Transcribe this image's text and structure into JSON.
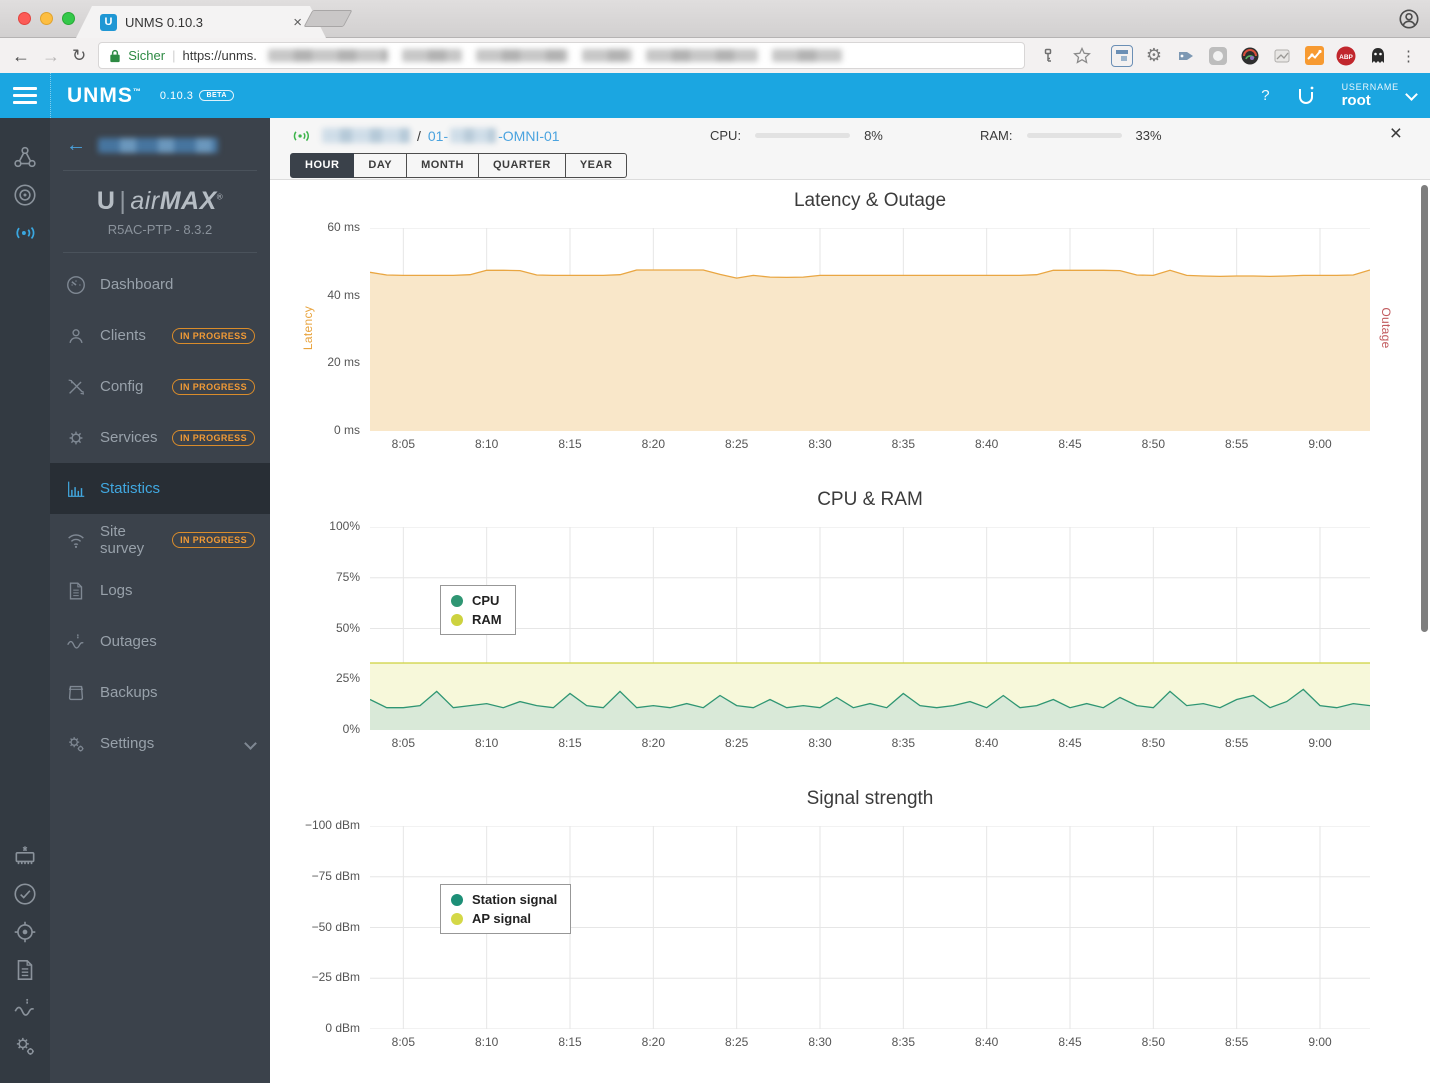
{
  "browser": {
    "tab_title": "UNMS 0.10.3",
    "favicon_letter": "U",
    "close_tab_glyph": "×",
    "nav": {
      "back": "←",
      "forward": "→",
      "reload": "↻"
    },
    "security_label": "Sicher",
    "url_divider": "|",
    "url_visible_text": "https://unms.",
    "menu_dots": "⋮",
    "extensions": [
      {
        "name": "key-icon"
      },
      {
        "name": "bookmark-star-icon"
      },
      {
        "name": "tab-window-extension-icon"
      },
      {
        "name": "gear-extension-icon"
      },
      {
        "name": "tag-extension-icon"
      },
      {
        "name": "circle-extension-icon"
      },
      {
        "name": "color-picker-extension-icon"
      },
      {
        "name": "notes-extension-icon"
      },
      {
        "name": "analytics-extension-icon"
      },
      {
        "name": "adblock-extension-icon",
        "label": "ABP"
      },
      {
        "name": "ghostery-extension-icon"
      }
    ]
  },
  "app_header": {
    "brand": "UNMS",
    "version": "0.10.3",
    "beta_badge": "BETA",
    "help_label": "?",
    "username_label": "USERNAME",
    "username_value": "root"
  },
  "sidebar": {
    "device_logo": {
      "u": "U",
      "bar": "|",
      "air": "air",
      "max": "MAX",
      "reg": "®"
    },
    "model_line": "R5AC-PTP - 8.3.2",
    "back_arrow": "←",
    "items": [
      {
        "label": "Dashboard",
        "badge": "",
        "active": false
      },
      {
        "label": "Clients",
        "badge": "IN PROGRESS",
        "active": false
      },
      {
        "label": "Config",
        "badge": "IN PROGRESS",
        "active": false
      },
      {
        "label": "Services",
        "badge": "IN PROGRESS",
        "active": false
      },
      {
        "label": "Statistics",
        "badge": "",
        "active": true
      },
      {
        "label": "Site survey",
        "badge": "IN PROGRESS",
        "active": false
      },
      {
        "label": "Logs",
        "badge": "",
        "active": false
      },
      {
        "label": "Outages",
        "badge": "",
        "active": false
      },
      {
        "label": "Backups",
        "badge": "",
        "active": false
      },
      {
        "label": "Settings",
        "badge": "",
        "active": false,
        "expandable": true
      }
    ]
  },
  "content": {
    "breadcrumb": {
      "separator": "/",
      "device_prefix": "01-",
      "device_suffix": "-OMNI-01"
    },
    "gauges": {
      "cpu_label": "CPU:",
      "cpu_value": "8%",
      "cpu_pct": 8,
      "ram_label": "RAM:",
      "ram_value": "33%",
      "ram_pct": 33,
      "bar_color": "#3f9e4c"
    },
    "close_glyph": "×",
    "tabs": [
      "HOUR",
      "DAY",
      "MONTH",
      "QUARTER",
      "YEAR"
    ],
    "active_tab": "HOUR"
  },
  "chart_data": [
    {
      "type": "area",
      "title": "Latency & Outage",
      "ylabel_left": "Latency",
      "ylabel_left_color": "#e8a33d",
      "ylabel_right": "Outage",
      "ylabel_right_color": "#c15b5e",
      "ytop": 60,
      "ybottom": 0,
      "yticks": [
        "60 ms",
        "40 ms",
        "20 ms",
        "0 ms"
      ],
      "ytick_values": [
        60,
        40,
        20,
        0
      ],
      "xticks": [
        "8:05",
        "8:10",
        "8:15",
        "8:20",
        "8:25",
        "8:30",
        "8:35",
        "8:40",
        "8:45",
        "8:50",
        "8:55",
        "9:00"
      ],
      "grid": true,
      "series": [
        {
          "name": "Latency",
          "color": "#e9a642",
          "fill": "#f9e7c9",
          "values": [
            46.9,
            46.1,
            46,
            46,
            46,
            46,
            46.2,
            47.5,
            47.5,
            47.4,
            46.1,
            46,
            46,
            46,
            46,
            46.2,
            47.6,
            47.6,
            47.6,
            47.6,
            47.6,
            46.3,
            45.2,
            46,
            45.5,
            45.4,
            45.5,
            46,
            46,
            46,
            46,
            46,
            46,
            46,
            46,
            46,
            46,
            46,
            46,
            46,
            46.2,
            47.5,
            47.5,
            47.5,
            47.5,
            47.4,
            46.1,
            46,
            47.5,
            46,
            45.8,
            45.7,
            45.8,
            45.8,
            45.7,
            45.8,
            46,
            46,
            46,
            46.1,
            47.6
          ]
        }
      ]
    },
    {
      "type": "area",
      "title": "CPU & RAM",
      "ytop": 100,
      "ybottom": 0,
      "yticks": [
        "100%",
        "75%",
        "50%",
        "25%",
        "0%"
      ],
      "ytick_values": [
        100,
        75,
        50,
        25,
        0
      ],
      "xticks": [
        "8:05",
        "8:10",
        "8:15",
        "8:20",
        "8:25",
        "8:30",
        "8:35",
        "8:40",
        "8:45",
        "8:50",
        "8:55",
        "9:00"
      ],
      "grid": true,
      "legend": [
        "CPU",
        "RAM"
      ],
      "series": [
        {
          "name": "RAM",
          "color": "#cdd23f",
          "fill": "#f7f8da",
          "values": [
            33,
            33,
            33,
            33,
            33,
            33,
            33,
            33,
            33,
            33,
            33,
            33,
            33,
            33,
            33,
            33,
            33,
            33,
            33,
            33,
            33,
            33,
            33,
            33,
            33,
            33,
            33,
            33,
            33,
            33,
            33,
            33,
            33,
            33,
            33,
            33,
            33,
            33,
            33,
            33,
            33,
            33,
            33,
            33,
            33,
            33,
            33,
            33,
            33,
            33,
            33,
            33,
            33,
            33,
            33,
            33,
            33,
            33,
            33,
            33,
            33
          ]
        },
        {
          "name": "CPU",
          "color": "#2f9673",
          "fill": "#d9e9d8",
          "values": [
            15,
            11,
            11,
            12,
            19,
            11,
            12,
            13,
            11,
            14,
            12,
            11,
            18,
            12,
            11,
            19,
            11,
            12,
            11,
            13,
            11,
            17,
            12,
            11,
            15,
            11,
            12,
            11,
            16,
            11,
            13,
            11,
            18,
            12,
            11,
            12,
            14,
            11,
            17,
            11,
            12,
            15,
            11,
            13,
            11,
            16,
            12,
            11,
            19,
            12,
            13,
            11,
            15,
            17,
            11,
            14,
            20,
            12,
            11,
            13,
            12
          ]
        }
      ]
    },
    {
      "type": "area",
      "title": "Signal strength",
      "ytop": -100,
      "ybottom": 0,
      "yticks": [
        "−100 dBm",
        "−75 dBm",
        "−50 dBm",
        "−25 dBm",
        "0 dBm"
      ],
      "ytick_values": [
        -100,
        -75,
        -50,
        -25,
        0
      ],
      "xticks": [
        "8:05",
        "8:10",
        "8:15",
        "8:20",
        "8:25",
        "8:30",
        "8:35",
        "8:40",
        "8:45",
        "8:50",
        "8:55",
        "9:00"
      ],
      "grid": true,
      "legend": [
        "Station signal",
        "AP signal"
      ],
      "series": [
        {
          "name": "Station signal",
          "color": "#1d8f77",
          "fill": "#d9e9d8",
          "values": []
        },
        {
          "name": "AP signal",
          "color": "#d4d847",
          "fill": "#f7f8da",
          "values": []
        }
      ]
    }
  ]
}
